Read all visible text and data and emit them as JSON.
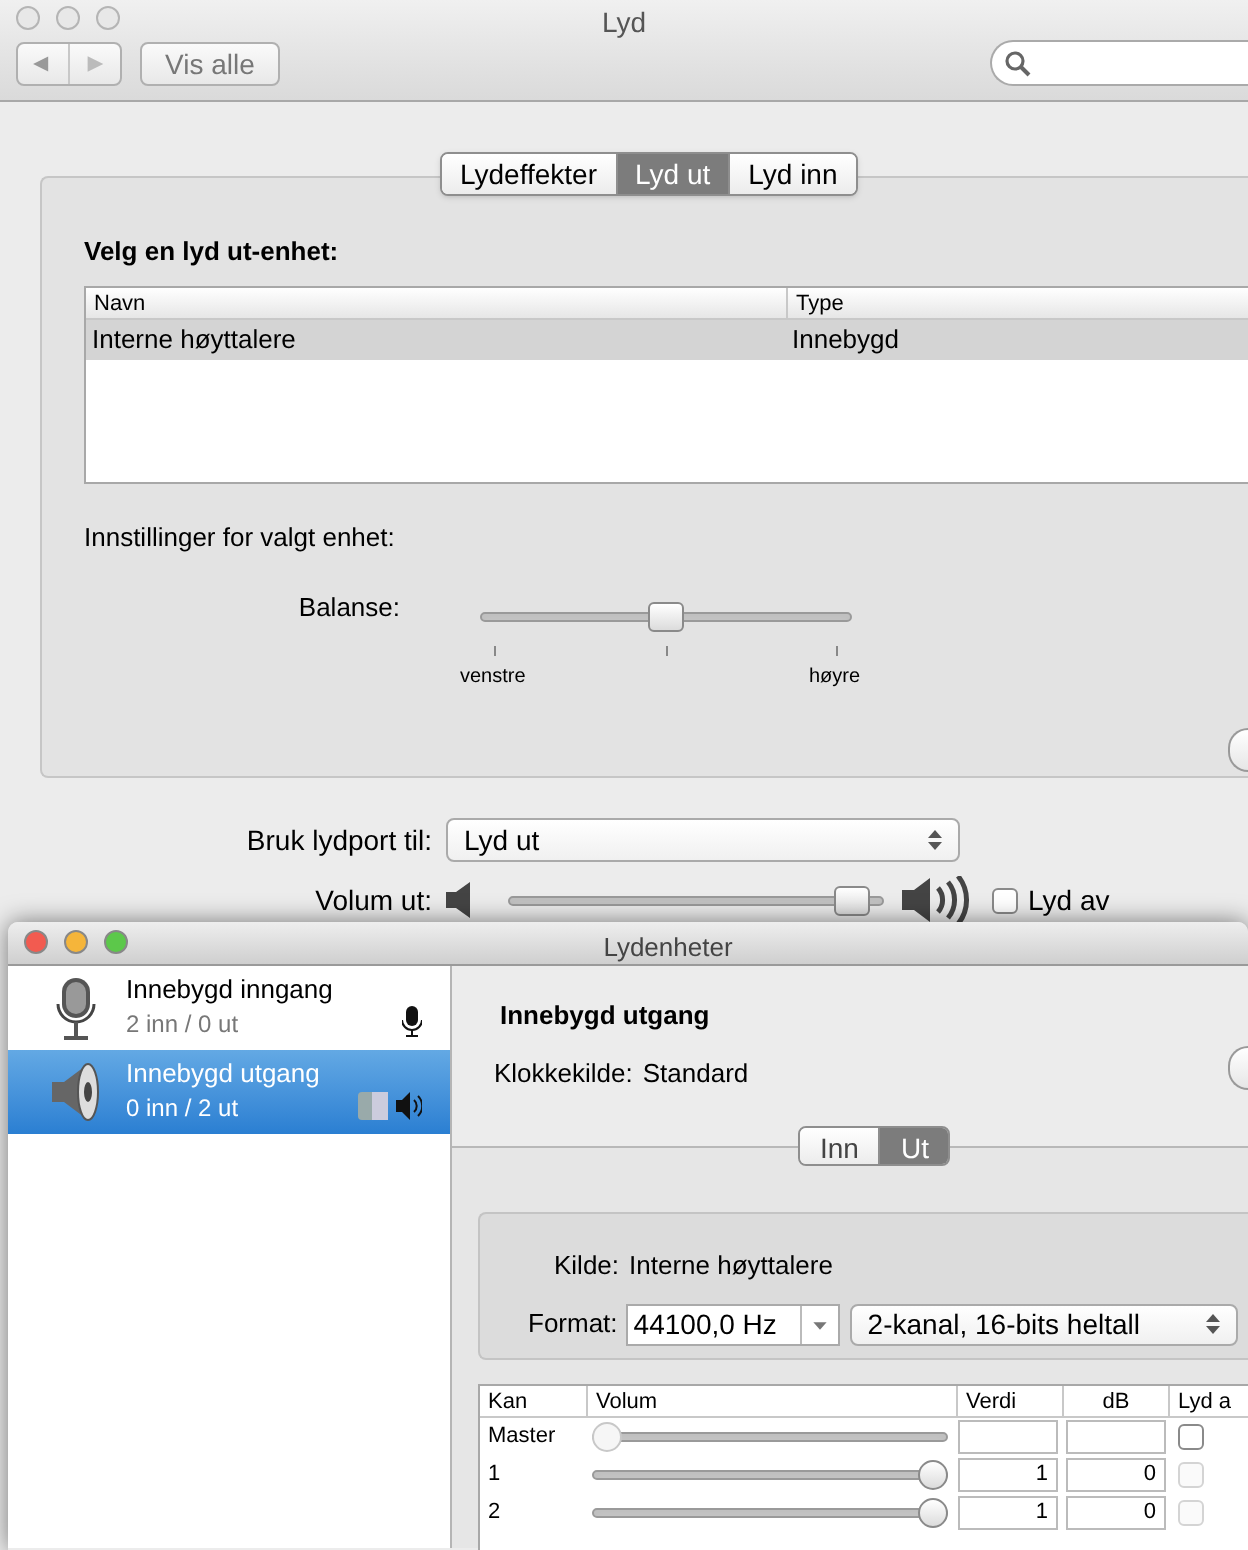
{
  "window": {
    "title": "Lyd",
    "show_all": "Vis alle"
  },
  "tabs": [
    {
      "label": "Lydeffekter",
      "selected": false
    },
    {
      "label": "Lyd ut",
      "selected": true
    },
    {
      "label": "Lyd inn",
      "selected": false
    }
  ],
  "device_heading": "Velg en lyd ut-enhet:",
  "device_table": {
    "columns": [
      "Navn",
      "Type"
    ],
    "rows": [
      {
        "name": "Interne høyttalere",
        "type": "Innebygd",
        "selected": true
      }
    ]
  },
  "settings_label": "Innstillinger for valgt enhet:",
  "balance": {
    "label": "Balanse:",
    "level": 0.5,
    "left": "venstre",
    "right": "høyre"
  },
  "port": {
    "label": "Bruk lydport til:",
    "value": "Lyd ut"
  },
  "volume": {
    "label": "Volum ut:",
    "level": 0.96,
    "mute_label": "Lyd av",
    "muted": false
  },
  "midi_window": {
    "title": "Lydenheter",
    "devices": [
      {
        "kind": "microphone",
        "name": "Innebygd inngang",
        "io": "2 inn / 0 ut",
        "selected": false
      },
      {
        "kind": "speaker",
        "name": "Innebygd utgang",
        "io": "0 inn / 2 ut",
        "selected": true
      }
    ],
    "detail_title": "Innebygd utgang",
    "clock_label": "Klokkekilde:",
    "clock_value": "Standard",
    "tabs": [
      {
        "label": "Inn",
        "selected": false
      },
      {
        "label": "Ut",
        "selected": true
      }
    ],
    "source_label": "Kilde:",
    "source_value": "Interne høyttalere",
    "format_label": "Format:",
    "rate": "44100,0 Hz",
    "format": "2-kanal, 16-bits heltall",
    "channel_table": {
      "columns": [
        "Kan",
        "Volum",
        "Verdi",
        "dB",
        "Lyd a"
      ],
      "rows": [
        {
          "channel": "Master",
          "level": 0,
          "slider_disabled": true,
          "muted": false,
          "mute_disabled": false
        },
        {
          "channel": "1",
          "level": 1,
          "value": "1",
          "db": "0",
          "slider_disabled": false,
          "muted": false,
          "mute_disabled": true
        },
        {
          "channel": "2",
          "level": 1,
          "value": "1",
          "db": "0",
          "slider_disabled": false,
          "muted": false,
          "mute_disabled": true
        }
      ]
    }
  }
}
